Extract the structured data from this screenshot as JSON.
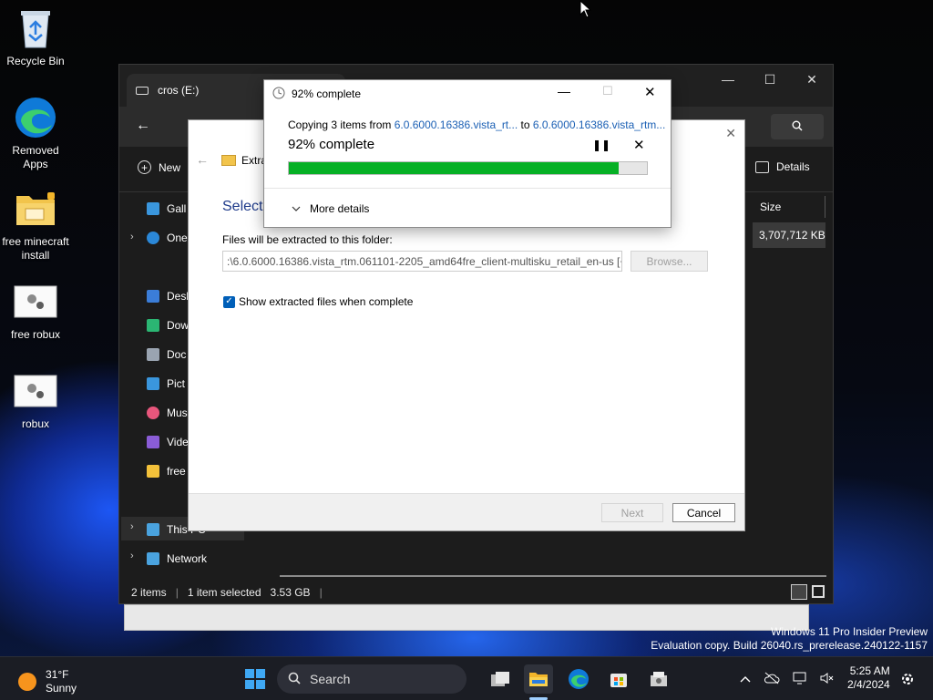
{
  "desktop": {
    "icons": [
      {
        "label": "Recycle Bin",
        "icon": "recycle-bin-icon"
      },
      {
        "label": "Removed Apps",
        "icon": "edge-icon"
      },
      {
        "label": "free minecraft install",
        "icon": "folder-lock-icon"
      },
      {
        "label": "free robux",
        "icon": "settings-file-icon"
      },
      {
        "label": "robux",
        "icon": "settings-file-icon"
      }
    ]
  },
  "explorer": {
    "tab_title": "cros (E:)",
    "new_label": "New",
    "details_label": "Details",
    "size_header": "Size",
    "size_value": "3,707,712 KB",
    "sidebar": [
      {
        "label": "Gall",
        "color": "#3a96dd"
      },
      {
        "label": "One",
        "color": "#2b88d8"
      },
      {
        "label": "Desl",
        "color": "#3b7dd8"
      },
      {
        "label": "Dow",
        "color": "#2bb673"
      },
      {
        "label": "Doc",
        "color": "#9aa4b1"
      },
      {
        "label": "Pict",
        "color": "#3a96dd"
      },
      {
        "label": "Mus",
        "color": "#e8567c"
      },
      {
        "label": "Vide",
        "color": "#8a5cd6"
      },
      {
        "label": "free",
        "color": "#f3c13a"
      },
      {
        "label": "This PC",
        "color": "#4aa3df"
      },
      {
        "label": "Network",
        "color": "#4aa3df"
      }
    ],
    "status": {
      "items": "2 items",
      "selected": "1 item selected",
      "size": "3.53 GB"
    }
  },
  "wizard": {
    "breadcrumb": "Extra",
    "heading": "Select",
    "folder_label": "Files will be extracted to this folder:",
    "folder_path": ":\\6.0.6000.16386.vista_rtm.061101-2205_amd64fre_client-multisku_retail_en-us [+]",
    "browse_label": "Browse...",
    "checkbox_label": "Show extracted files when complete",
    "checkbox_checked": true,
    "next_label": "Next",
    "cancel_label": "Cancel"
  },
  "copy_dialog": {
    "title": "92% complete",
    "copying_prefix": "Copying 3 items from",
    "from": "6.0.6000.16386.vista_rt...",
    "to_word": "to",
    "to": "6.0.6000.16386.vista_rtm...",
    "percent_text": "92% complete",
    "progress": 0.92,
    "more_details": "More details",
    "progress_color": "#06b025"
  },
  "watermark": {
    "line1": "Windows 11 Pro Insider Preview",
    "line2": "Evaluation copy. Build 26040.rs_prerelease.240122-1157"
  },
  "taskbar": {
    "weather_temp": "31°F",
    "weather_desc": "Sunny",
    "search_label": "Search",
    "time": "5:25 AM",
    "date": "2/4/2024"
  }
}
